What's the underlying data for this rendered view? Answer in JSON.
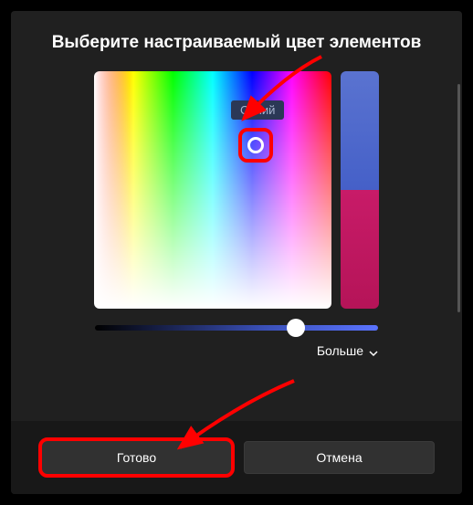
{
  "dialog": {
    "title": "Выберите настраиваемый цвет элементов",
    "colorTooltip": "Синий",
    "moreLabel": "Больше",
    "doneLabel": "Готово",
    "cancelLabel": "Отмена"
  },
  "colors": {
    "selected": "#4560c8",
    "previewTop": "#5a73d0",
    "previewBottom": "#c81b68"
  }
}
